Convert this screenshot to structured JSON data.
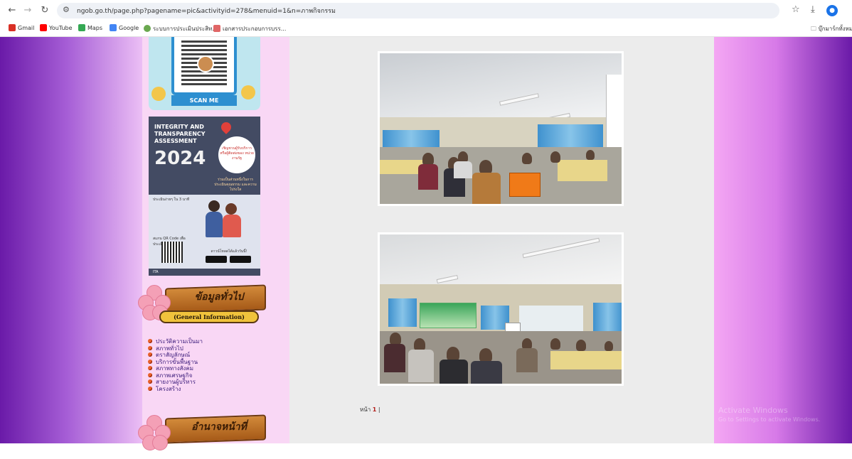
{
  "browser": {
    "url": "ngob.go.th/page.php?pagename=pic&activityid=278&menuid=1&n=ภาพกิจกรรม",
    "bookmarks": [
      {
        "label": "Gmail",
        "color": "#d93025"
      },
      {
        "label": "YouTube",
        "color": "#ff0000"
      },
      {
        "label": "Maps",
        "color": "#34a853"
      },
      {
        "label": "Google",
        "color": "#4285f4"
      },
      {
        "label": "ระบบการประเมินประสิท...",
        "color": "#6aa84f"
      },
      {
        "label": "เอกสารประกอบการบรร...",
        "color": "#e06666"
      }
    ],
    "all_bookmarks": "บุ๊กมาร์กทั้งหมด"
  },
  "sidebar": {
    "qr_label": "SCAN ME",
    "ita": {
      "title": "INTEGRITY AND TRANSPARENCY ASSESSMENT",
      "year": "2024",
      "bubble": "เชิญชวนผู้รับบริการ หรือผู้ติดต่อของ หน่วยงานรัฐ",
      "sub": "ร่วมเป็นส่วนหนึ่งในการ ประเมินคุณธรรม และความโปร่งใส",
      "steps": "ประเมินง่ายๆ ใน 3 นาที",
      "qr_text": "สแกน QR Code เพื่อประเมินทันที",
      "download": "ดาวน์โหลดได้แล้ววันนี้!",
      "footer": "ITA"
    },
    "banner1": {
      "title": "ข้อมูลทั่วไป",
      "subtitle": "(General Information)"
    },
    "menu": [
      "ประวัติความเป็นมา",
      "สภาพทั่วไป",
      "ตราสัญลักษณ์",
      "บริการขั้นพื้นฐาน",
      "สภาพทางสังคม",
      "สภาพเศรษฐกิจ",
      "สายงานผู้บริหาร",
      "โครงสร้าง"
    ],
    "banner2": {
      "title": "อำนาจหน้าที่"
    }
  },
  "content": {
    "pager_label": "หน้า",
    "pager_current": "1",
    "pager_sep": "|"
  },
  "watermark": {
    "line1": "Activate Windows",
    "line2": "Go to Settings to activate Windows."
  }
}
